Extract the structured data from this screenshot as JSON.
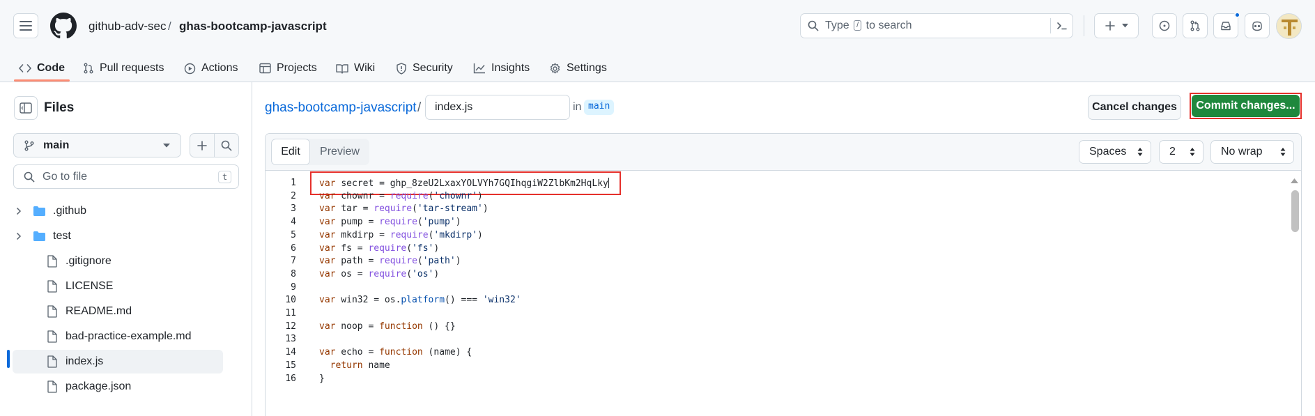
{
  "header": {
    "owner": "github-adv-sec",
    "separator": "/",
    "repo": "ghas-bootcamp-javascript",
    "search_prefix": "Type",
    "search_key": "/",
    "search_suffix": "to search",
    "notification_color": "#0969da"
  },
  "repo_nav": {
    "tabs": [
      {
        "label": "Code",
        "icon": "code-icon"
      },
      {
        "label": "Pull requests",
        "icon": "git-pull-request-icon"
      },
      {
        "label": "Actions",
        "icon": "play-icon"
      },
      {
        "label": "Projects",
        "icon": "table-icon"
      },
      {
        "label": "Wiki",
        "icon": "book-icon"
      },
      {
        "label": "Security",
        "icon": "shield-icon"
      },
      {
        "label": "Insights",
        "icon": "graph-icon"
      },
      {
        "label": "Settings",
        "icon": "gear-icon"
      }
    ],
    "selected": "Code",
    "underline_color": "#fd8c73"
  },
  "sidebar": {
    "title": "Files",
    "branch": "main",
    "goto_placeholder": "Go to file",
    "goto_shortcut": "t",
    "tree": [
      {
        "label": ".github",
        "type": "folder"
      },
      {
        "label": "test",
        "type": "folder"
      },
      {
        "label": ".gitignore",
        "type": "file"
      },
      {
        "label": "LICENSE",
        "type": "file"
      },
      {
        "label": "README.md",
        "type": "file"
      },
      {
        "label": "bad-practice-example.md",
        "type": "file"
      },
      {
        "label": "index.js",
        "type": "file",
        "selected": true
      },
      {
        "label": "package.json",
        "type": "file"
      }
    ]
  },
  "editor": {
    "repo_link": "ghas-bootcamp-javascript",
    "path_separator": "/",
    "filename": "index.js",
    "in_label": "in",
    "branch": "main",
    "cancel_label": "Cancel changes",
    "commit_label": "Commit changes...",
    "commit_color": "#1f883d",
    "highlight_color": "#e5302b",
    "tab_edit": "Edit",
    "tab_preview": "Preview",
    "indent_mode": "Spaces",
    "indent_size": "2",
    "wrap_mode": "No wrap",
    "lines": [
      {
        "n": "1",
        "tokens": [
          [
            "kw",
            "var"
          ],
          [
            "",
            "secret = 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"
          ]
        ]
      },
      {
        "n": "2",
        "tokens": [
          [
            "kw",
            "var"
          ],
          [
            "",
            " chownr = "
          ],
          [
            "kw2",
            "require"
          ],
          [
            "",
            "("
          ],
          [
            "str",
            "'chownr'"
          ],
          [
            "",
            ")"
          ]
        ]
      },
      {
        "n": "3",
        "tokens": [
          [
            "kw",
            "var"
          ],
          [
            "",
            " tar = "
          ],
          [
            "kw2",
            "require"
          ],
          [
            "",
            "("
          ],
          [
            "str",
            "'tar-stream'"
          ],
          [
            "",
            ")"
          ]
        ]
      },
      {
        "n": "4",
        "tokens": [
          [
            "kw",
            "var"
          ],
          [
            "",
            " pump = "
          ],
          [
            "kw2",
            "require"
          ],
          [
            "",
            "("
          ],
          [
            "str",
            "'pump'"
          ],
          [
            "",
            ")"
          ]
        ]
      },
      {
        "n": "5",
        "tokens": [
          [
            "kw",
            "var"
          ],
          [
            "",
            " mkdirp = "
          ],
          [
            "kw2",
            "require"
          ],
          [
            "",
            "("
          ],
          [
            "str",
            "'mkdirp'"
          ],
          [
            "",
            ")"
          ]
        ]
      },
      {
        "n": "6",
        "tokens": [
          [
            "kw",
            "var"
          ],
          [
            "",
            " fs = "
          ],
          [
            "kw2",
            "require"
          ],
          [
            "",
            "("
          ],
          [
            "str",
            "'fs'"
          ],
          [
            "",
            ")"
          ]
        ]
      },
      {
        "n": "7",
        "tokens": [
          [
            "kw",
            "var"
          ],
          [
            "",
            " path = "
          ],
          [
            "kw2",
            "require"
          ],
          [
            "",
            "("
          ],
          [
            "str",
            "'path'"
          ],
          [
            "",
            ")"
          ]
        ]
      },
      {
        "n": "8",
        "tokens": [
          [
            "kw",
            "var"
          ],
          [
            "",
            " os = "
          ],
          [
            "kw2",
            "require"
          ],
          [
            "",
            "("
          ],
          [
            "str",
            "'os'"
          ],
          [
            "",
            ")"
          ]
        ]
      },
      {
        "n": "9",
        "tokens": []
      },
      {
        "n": "10",
        "tokens": [
          [
            "kw",
            "var"
          ],
          [
            "",
            " win32 = os."
          ],
          [
            "prop",
            "platform"
          ],
          [
            "",
            "() === "
          ],
          [
            "str",
            "'win32'"
          ]
        ]
      },
      {
        "n": "11",
        "tokens": []
      },
      {
        "n": "12",
        "tokens": [
          [
            "kw",
            "var"
          ],
          [
            "",
            " noop = "
          ],
          [
            "kw",
            "function"
          ],
          [
            "",
            " () {}"
          ]
        ]
      },
      {
        "n": "13",
        "tokens": []
      },
      {
        "n": "14",
        "tokens": [
          [
            "kw",
            "var"
          ],
          [
            "",
            " echo = "
          ],
          [
            "kw",
            "function"
          ],
          [
            "",
            " (name) {"
          ]
        ]
      },
      {
        "n": "15",
        "tokens": [
          [
            "",
            "  "
          ],
          [
            "kw",
            "return"
          ],
          [
            "",
            " name"
          ]
        ]
      },
      {
        "n": "16",
        "tokens": [
          [
            "",
            "}"
          ]
        ]
      }
    ]
  }
}
